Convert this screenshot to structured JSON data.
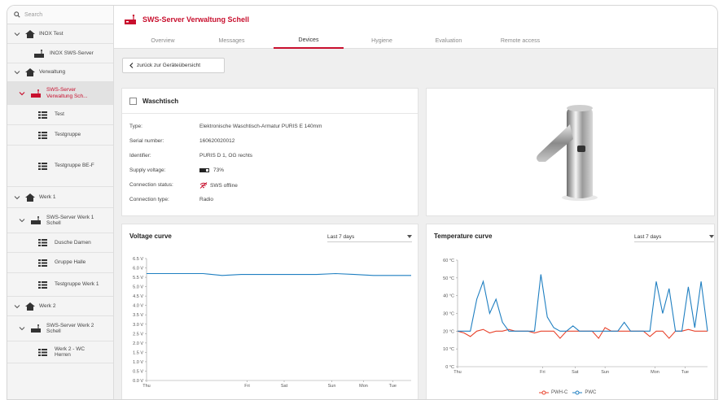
{
  "search": {
    "placeholder": "Search"
  },
  "sidebar": {
    "items": [
      {
        "label": "INOX Test"
      },
      {
        "label": "INOX SWS-Server"
      },
      {
        "label": "Verwaltung"
      },
      {
        "label_1": "SWS-Server",
        "label_2": "Verwaltung Sch..."
      },
      {
        "label": "Test"
      },
      {
        "label": "Testgruppe"
      },
      {
        "label": "Testgruppe BE-F"
      },
      {
        "label": "Werk 1"
      },
      {
        "label_1": "SWS-Server Werk 1",
        "label_2": "Schell"
      },
      {
        "label": "Dusche Damen"
      },
      {
        "label": "Gruppe Halle"
      },
      {
        "label": "Testgruppe Werk 1"
      },
      {
        "label": "Werk 2"
      },
      {
        "label_1": "SWS-Server Werk 2",
        "label_2": "Schell"
      },
      {
        "label_1": "Werk 2 - WC",
        "label_2": "Herren"
      }
    ]
  },
  "header": {
    "title": "SWS-Server Verwaltung Schell",
    "tabs": [
      "Overview",
      "Messages",
      "Devices",
      "Hygiene",
      "Evaluation",
      "Remote access"
    ],
    "active_tab": "Devices"
  },
  "back_button": {
    "label": "zurück zur Geräteübersicht"
  },
  "device": {
    "name": "Waschtisch",
    "fields": [
      {
        "key": "Type:",
        "value": "Elektronische Waschtisch-Armatur PURIS E 140mm"
      },
      {
        "key": "Serial number:",
        "value": "160620020012"
      },
      {
        "key": "Identifier:",
        "value": "PURIS D 1, OG rechts"
      },
      {
        "key": "Supply voltage:",
        "value": "73%"
      },
      {
        "key": "Connection status:",
        "value": "SWS offline"
      },
      {
        "key": "Connection type:",
        "value": "Radio"
      }
    ],
    "battery_level": 0.73
  },
  "colors": {
    "accent": "#c8102e",
    "line_blue": "#1f7fc1",
    "line_red": "#e8432c"
  },
  "voltage_chart": {
    "title": "Voltage curve",
    "range_label": "Last 7 days",
    "y_ticks": [
      "6.5 V",
      "6.0 V",
      "5.5 V",
      "5.0 V",
      "4.5 V",
      "4.0 V",
      "3.5 V",
      "3.0 V",
      "2.5 V",
      "2.0 V",
      "1.5 V",
      "1.0 V",
      "0.5 V",
      "0.0 V"
    ],
    "x_ticks": [
      "Thu",
      "Fri",
      "Sat",
      "Sun",
      "Mon",
      "Tue"
    ]
  },
  "temperature_chart": {
    "title": "Temperature curve",
    "range_label": "Last 7 days",
    "y_ticks": [
      "60 °C",
      "50 °C",
      "40 °C",
      "30 °C",
      "20 °C",
      "10 °C",
      "0 °C"
    ],
    "x_ticks": [
      "Thu",
      "Fri",
      "Sat",
      "Sun",
      "Mon",
      "Tue"
    ],
    "legend": [
      "PWH-C",
      "PWC"
    ]
  },
  "chart_data": [
    {
      "type": "line",
      "title": "Voltage curve",
      "ylim": [
        0,
        6.5
      ],
      "x": [
        "Thu",
        "Thu",
        "Thu",
        "Fri",
        "Fri",
        "Fri",
        "Sat",
        "Sat",
        "Sun",
        "Sun",
        "Mon",
        "Mon",
        "Tue",
        "Tue",
        "Tue"
      ],
      "series": [
        {
          "values": [
            5.7,
            5.7,
            5.7,
            5.7,
            5.6,
            5.65,
            5.65,
            5.65,
            5.65,
            5.65,
            5.7,
            5.65,
            5.6,
            5.6,
            5.6
          ]
        }
      ]
    },
    {
      "type": "line",
      "title": "Temperature curve",
      "ylim": [
        0,
        60
      ],
      "series": [
        {
          "name": "PWH-C",
          "values": [
            20,
            19,
            17,
            20,
            21,
            19,
            20,
            20,
            21,
            20,
            20,
            20,
            19,
            20,
            20,
            20,
            16,
            20,
            20,
            20,
            20,
            20,
            16,
            22,
            20,
            20,
            20,
            20,
            20,
            20,
            17,
            20,
            20,
            16,
            20,
            20,
            21,
            20,
            20,
            20
          ]
        },
        {
          "name": "PWC",
          "values": [
            20,
            20,
            20,
            38,
            48,
            30,
            38,
            25,
            20,
            20,
            20,
            20,
            20,
            52,
            28,
            22,
            20,
            20,
            23,
            20,
            20,
            20,
            20,
            20,
            20,
            20,
            25,
            20,
            20,
            20,
            20,
            48,
            30,
            44,
            20,
            20,
            45,
            22,
            48,
            20
          ]
        }
      ]
    }
  ]
}
